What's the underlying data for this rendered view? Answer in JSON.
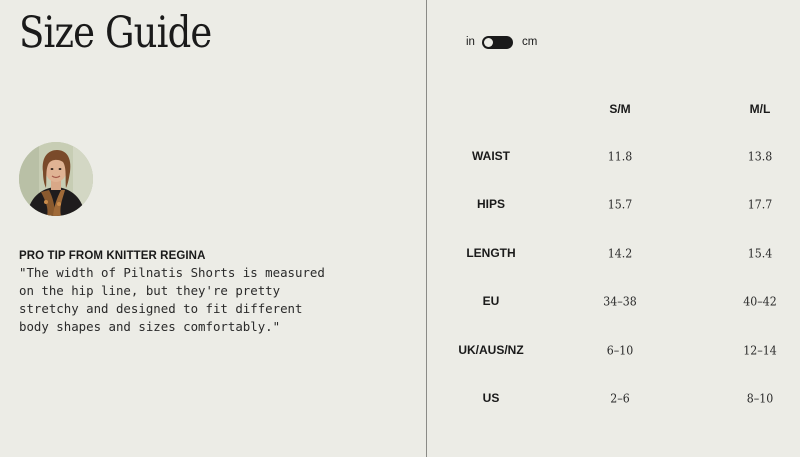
{
  "title": "Size Guide",
  "tip": {
    "heading": "PRO TIP FROM KNITTER REGINA",
    "quote": "\"The width of Pilnatis Shorts is measured on the hip line, but they're pretty stretchy and designed to fit different body shapes and sizes comfortably.\""
  },
  "unit_toggle": {
    "left_label": "in",
    "right_label": "cm",
    "selected": "in"
  },
  "table": {
    "columns": [
      "S/M",
      "M/L"
    ],
    "rows": [
      {
        "label": "WAIST",
        "values": [
          "11.8",
          "13.8"
        ]
      },
      {
        "label": "HIPS",
        "values": [
          "15.7",
          "17.7"
        ]
      },
      {
        "label": "LENGTH",
        "values": [
          "14.2",
          "15.4"
        ]
      },
      {
        "label": "EU",
        "values": [
          "34–38",
          "40–42"
        ]
      },
      {
        "label": "UK/AUS/NZ",
        "values": [
          "6–10",
          "12–14"
        ]
      },
      {
        "label": "US",
        "values": [
          "2–6",
          "8–10"
        ]
      }
    ]
  }
}
